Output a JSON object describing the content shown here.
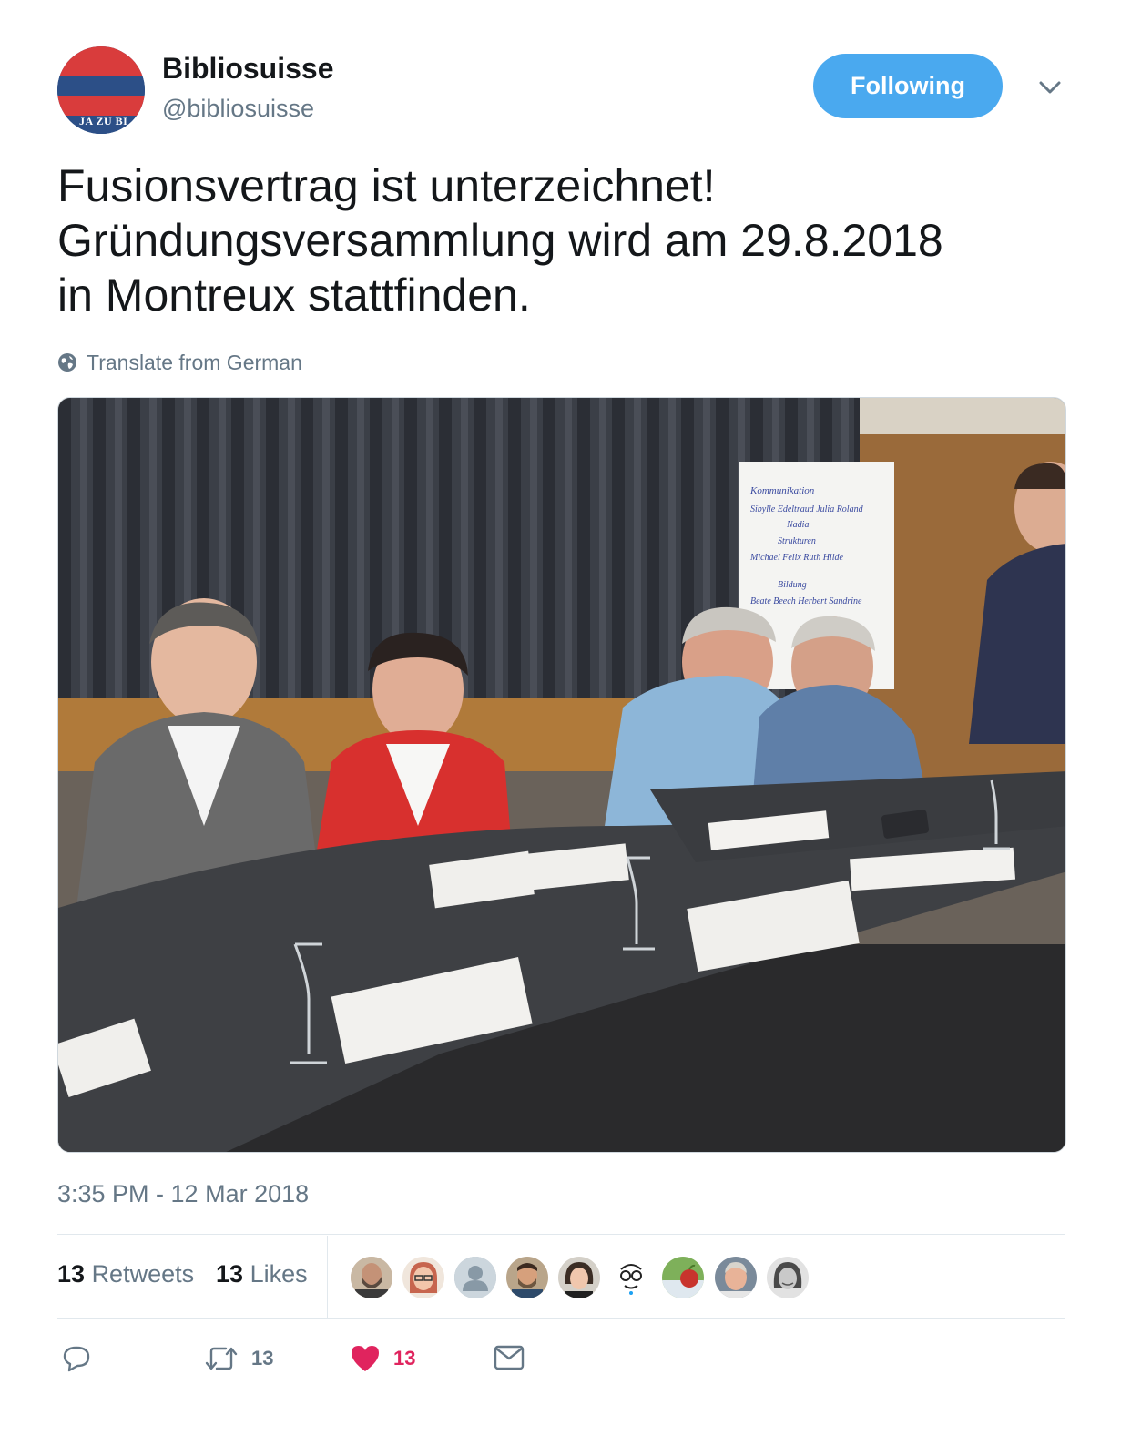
{
  "user": {
    "display_name": "Bibliosuisse",
    "handle": "@bibliosuisse",
    "avatar_text": "JA ZU BI"
  },
  "follow_button": {
    "label": "Following"
  },
  "tweet": {
    "text": "Fusionsvertrag ist unterzeichnet!\nGründungsversammlung wird am 29.8.2018\nin Montreux stattfinden.",
    "translate_label": "Translate from German",
    "timestamp": "3:35 PM - 12 Mar 2018"
  },
  "photo": {
    "flipchart_lines": [
      "Kommunikation",
      "Sibylle  Edeltraud  Julia  Roland",
      "Nadia",
      "Strukturen",
      "Michael  Felix  Ruth  Hilde",
      "Bildung",
      "Beate  Beech  Herbert  Sandrine"
    ]
  },
  "stats": {
    "retweets_count": "13",
    "retweets_label": "Retweets",
    "likes_count": "13",
    "likes_label": "Likes"
  },
  "likers": [
    {
      "icon": "avatar-bearded-man",
      "color": "#5a4a3f"
    },
    {
      "icon": "avatar-woman-glasses",
      "color": "#c7654e"
    },
    {
      "icon": "avatar-default-silhouette",
      "color": "#aab8c2"
    },
    {
      "icon": "avatar-man-beard",
      "color": "#6d5640"
    },
    {
      "icon": "avatar-woman-dark-hair",
      "color": "#3b2d24"
    },
    {
      "icon": "avatar-cartoon-glasses",
      "color": "#ffffff"
    },
    {
      "icon": "avatar-apple",
      "color": "#c8342d"
    },
    {
      "icon": "avatar-grey-hair-man",
      "color": "#7a8a9a"
    },
    {
      "icon": "avatar-woman-bw",
      "color": "#4a4a4a"
    }
  ],
  "actions": {
    "reply_count": "",
    "retweet_count": "13",
    "like_count": "13"
  },
  "colors": {
    "accent": "#1da1f2",
    "follow_button": "#4aa9ef",
    "like_red": "#e0245e",
    "secondary_text": "#657786"
  }
}
